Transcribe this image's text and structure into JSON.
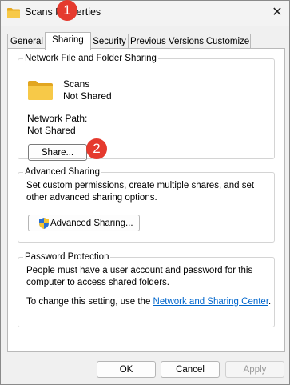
{
  "window": {
    "title": "Scans Properties",
    "close_glyph": "✕"
  },
  "tabs": [
    {
      "label": "General"
    },
    {
      "label": "Sharing"
    },
    {
      "label": "Security"
    },
    {
      "label": "Previous Versions"
    },
    {
      "label": "Customize"
    }
  ],
  "network_sharing": {
    "legend": "Network File and Folder Sharing",
    "folder_name": "Scans",
    "share_status": "Not Shared",
    "network_path_label": "Network Path:",
    "network_path_value": "Not Shared",
    "share_button": "Share..."
  },
  "advanced_sharing": {
    "legend": "Advanced Sharing",
    "description": "Set custom permissions, create multiple shares, and set other advanced sharing options.",
    "button": "Advanced Sharing..."
  },
  "password_protection": {
    "legend": "Password Protection",
    "description": "People must have a user account and password for this computer to access shared folders.",
    "change_prefix": "To change this setting, use the ",
    "link_text": "Network and Sharing Center",
    "change_suffix": "."
  },
  "footer": {
    "ok": "OK",
    "cancel": "Cancel",
    "apply": "Apply"
  },
  "annotations": [
    {
      "label": "1"
    },
    {
      "label": "2"
    }
  ],
  "icons": {
    "folder": "folder-icon",
    "shield": "uac-shield-icon",
    "close": "close-icon"
  },
  "colors": {
    "marker": "#e53a2e",
    "link": "#0066cc",
    "folder": "#f2c34c"
  }
}
